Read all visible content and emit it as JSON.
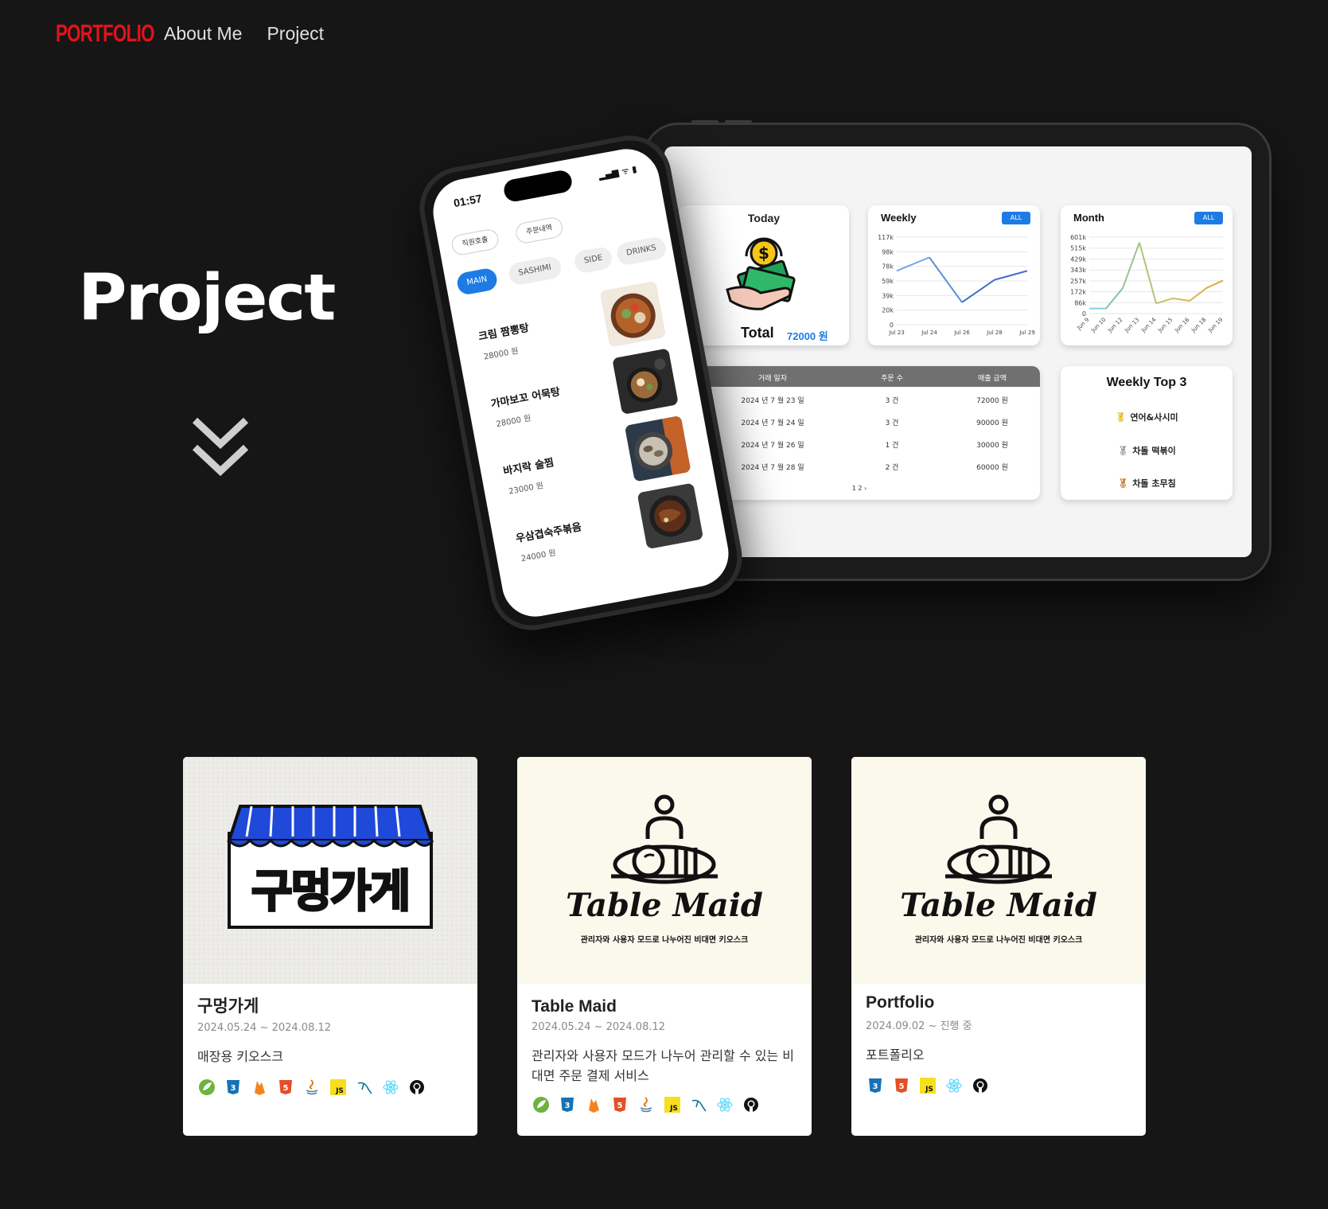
{
  "nav": {
    "logo": "PORTFOLIO",
    "links": [
      "About Me",
      "Project"
    ]
  },
  "hero": {
    "title": "Project"
  },
  "tablet": {
    "today": {
      "title": "Today",
      "total_label": "Total",
      "total_value": "72000 원"
    },
    "weekly": {
      "title": "Weekly",
      "badge": "ALL",
      "y_ticks": [
        "117k",
        "98k",
        "78k",
        "59k",
        "39k",
        "20k",
        "0"
      ],
      "x_ticks": [
        "Jul 23",
        "Jul 24",
        "Jul 26",
        "Jul 28",
        "Jul 29"
      ],
      "values": [
        72000,
        90000,
        30000,
        60000,
        72000
      ]
    },
    "month": {
      "title": "Month",
      "badge": "ALL",
      "y_ticks": [
        "601k",
        "515k",
        "429k",
        "343k",
        "257k",
        "172k",
        "86k",
        "0"
      ],
      "x_ticks": [
        "Jun 9",
        "Jun 10",
        "Jun 12",
        "Jun 13",
        "Jun 14",
        "Jun 15",
        "Jun 16",
        "Jun 18",
        "Jun 19"
      ],
      "values": [
        40000,
        40000,
        200000,
        560000,
        80000,
        120000,
        100000,
        200000,
        260000
      ]
    },
    "table": {
      "headers": [
        "거래 일자",
        "주문 수",
        "매출 금액"
      ],
      "rows": [
        [
          "2024 년 7 월 23 일",
          "3 건",
          "72000 원"
        ],
        [
          "2024 년 7 월 24 일",
          "3 건",
          "90000 원"
        ],
        [
          "2024 년 7 월 26 일",
          "1 건",
          "30000 원"
        ],
        [
          "2024 년 7 월 28 일",
          "2 건",
          "60000 원"
        ]
      ],
      "pager": "1  2  ›"
    },
    "top3": {
      "title": "Weekly Top 3",
      "items": [
        "연어&사시미",
        "차돌 떡볶이",
        "차돌 초무침"
      ]
    }
  },
  "phone": {
    "clock": "01:57",
    "status": "▂▄▆ ᯤ ▮",
    "top_buttons": [
      "직원호출",
      "주문내역"
    ],
    "tabs": [
      "MAIN",
      "SASHIMI",
      "SIDE",
      "DRINKS"
    ],
    "menu": [
      {
        "name": "크림 짬뽕탕",
        "price": "28000 원"
      },
      {
        "name": "가마보꼬 어묵탕",
        "price": "28000 원"
      },
      {
        "name": "바지락 술찜",
        "price": "23000 원"
      },
      {
        "name": "우삼겹숙주볶음",
        "price": "24000 원"
      }
    ]
  },
  "projects": [
    {
      "logo_text": "구멍가게",
      "title": "구멍가게",
      "date": "2024.05.24 ~ 2024.08.12",
      "desc": "매장용 키오스크",
      "tech": [
        "spring",
        "css3",
        "firebase",
        "html5",
        "java",
        "javascript",
        "mysql",
        "react",
        "github"
      ]
    },
    {
      "logo_text": "Table Maid",
      "logo_sub": "관리자와 사용자 모드로 나누어진 비대면 키오스크",
      "title": "Table Maid",
      "date": "2024.05.24 ~ 2024.08.12",
      "desc": "관리자와 사용자 모드가 나누어 관리할 수 있는 비대면 주문 결제 서비스",
      "tech": [
        "spring",
        "css3",
        "firebase",
        "html5",
        "java",
        "javascript",
        "mysql",
        "react",
        "github"
      ]
    },
    {
      "logo_text": "Table Maid",
      "logo_sub": "관리자와 사용자 모드로 나누어진 비대면 키오스크",
      "title": "Portfolio",
      "date": "2024.09.02 ~ 진행 중",
      "desc": "포트폴리오",
      "tech": [
        "css3",
        "html5",
        "javascript",
        "react",
        "github"
      ]
    }
  ],
  "colors": {
    "accent_red": "#e3121b",
    "chart_blue": "#1e7be3",
    "background": "#161616"
  }
}
